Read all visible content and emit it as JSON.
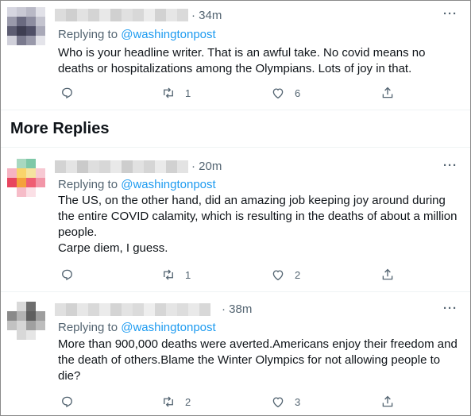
{
  "section_title": "More Replies",
  "tweets": [
    {
      "time": "· 34m",
      "replying_prefix": "Replying to ",
      "replying_handle": "@washingtonpost",
      "lines": [
        "Who is your headline writer. That is an awful take. No covid means no deaths or hospitalizations among the Olympians. Lots of joy in that."
      ],
      "reply_count": "",
      "retweet_count": "1",
      "like_count": "6"
    },
    {
      "time": "· 20m",
      "replying_prefix": "Replying to ",
      "replying_handle": "@washingtonpost",
      "lines": [
        "The US, on the other hand, did an amazing job keeping joy around during the entire COVID calamity, which is resulting in the deaths of about a million people.",
        "Carpe diem, I guess."
      ],
      "reply_count": "",
      "retweet_count": "1",
      "like_count": "2"
    },
    {
      "time": "· 38m",
      "replying_prefix": "Replying to ",
      "replying_handle": "@washingtonpost",
      "lines": [
        "More than 900,000 deaths were averted.Americans enjoy their freedom and the death of others.Blame the Winter Olympics for not allowing people to die?"
      ],
      "reply_count": "",
      "retweet_count": "2",
      "like_count": "3"
    }
  ],
  "colors": {
    "text": "#0f1419",
    "secondary": "#536471",
    "link": "#1d9bf0",
    "divider": "#eff3f4"
  },
  "icons": {
    "reply": "reply-icon",
    "retweet": "retweet-icon",
    "like": "like-icon",
    "share": "share-icon",
    "more": "more-icon"
  }
}
